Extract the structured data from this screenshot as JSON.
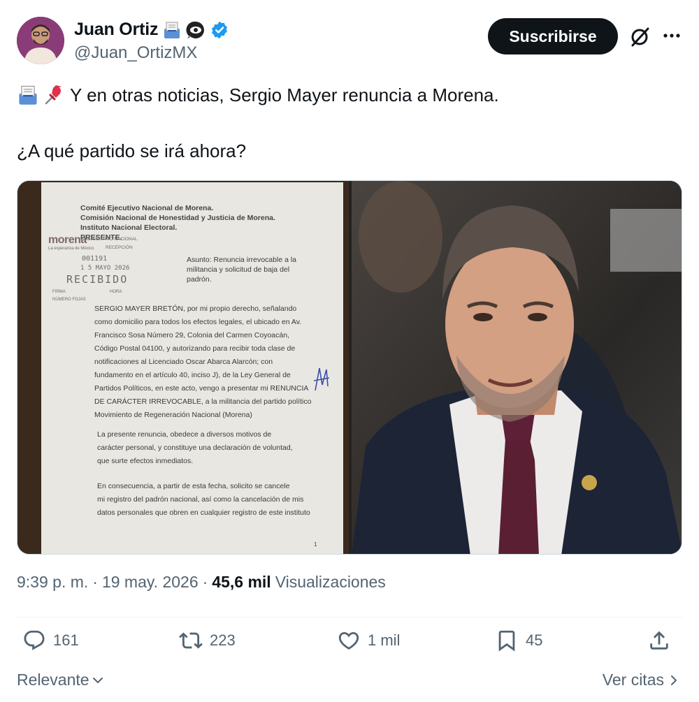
{
  "author": {
    "display_name": "Juan Ortiz",
    "handle": "@Juan_OrtizMX"
  },
  "header": {
    "subscribe_label": "Suscribirse",
    "grok_icon": "grok-slash-circle-icon",
    "more_icon": "more-horizontal-icon"
  },
  "tweet": {
    "line1": "Y en otras noticias, Sergio Mayer renuncia a Morena.",
    "line2": "¿A qué partido se irá ahora?"
  },
  "document": {
    "lines_top": [
      "Comité Ejecutivo Nacional de Morena.",
      "Comisión Nacional de Honestidad y Justicia de Morena.",
      "Instituto Nacional Electoral.",
      "PRESENTE."
    ],
    "stamp": {
      "org": "morena",
      "tagline": "La esperanza de México",
      "dept": "EJECUTIVO NACIONAL",
      "reception": "RECEPCIÓN",
      "number": "001191",
      "date": "1 5 MAYO 2026",
      "received": "RECIBIDO",
      "firma": "FIRMA",
      "hora": "HORA",
      "fojas": "NÚMERO FOJAS"
    },
    "asunto": [
      "Asunto: Renuncia irrevocable a la",
      "militancia y solicitud de baja del",
      "padrón."
    ],
    "body": [
      "SERGIO MAYER BRETÓN, por mi propio derecho, señalando",
      "como domicilio para todos los efectos legales, el ubicado en Av.",
      "Francisco Sosa Número 29, Colonia del Carmen Coyoacán,",
      "Código Postal 04100, y autorizando para recibir toda clase de",
      "notificaciones al Licenciado Oscar Abarca Alarcón; con",
      "fundamento en el artículo 40, inciso J), de la Ley General de",
      "Partidos Políticos, en este acto, vengo a presentar mi RENUNCIA",
      "DE CARÁCTER IRREVOCABLE, a la militancia del partido político",
      "Movimiento de Regeneración Nacional (Morena)"
    ],
    "body2": [
      "La presente renuncia, obedece a diversos motivos de",
      "carácter personal, y constituye una declaración de voluntad,",
      "que surte efectos inmediatos."
    ],
    "body3": [
      "En consecuencia, a partir de esta fecha, solicito se cancele",
      "mi registro del padrón nacional, así como la cancelación de mis",
      "datos personales que obren en cualquier registro de este instituto"
    ],
    "page_number": "1"
  },
  "meta": {
    "time": "9:39 p. m.",
    "separator": "·",
    "date": "19 may. 2026",
    "views_count": "45,6 mil",
    "views_label": "Visualizaciones"
  },
  "actions": {
    "replies": "161",
    "reposts": "223",
    "likes": "1 mil",
    "bookmarks": "45"
  },
  "footer": {
    "sort_label": "Relevante",
    "quotes_label": "Ver citas"
  },
  "colors": {
    "text": "#0f1419",
    "secondary": "#536471",
    "verified": "#1d9bf0",
    "button": "#0f1419"
  }
}
